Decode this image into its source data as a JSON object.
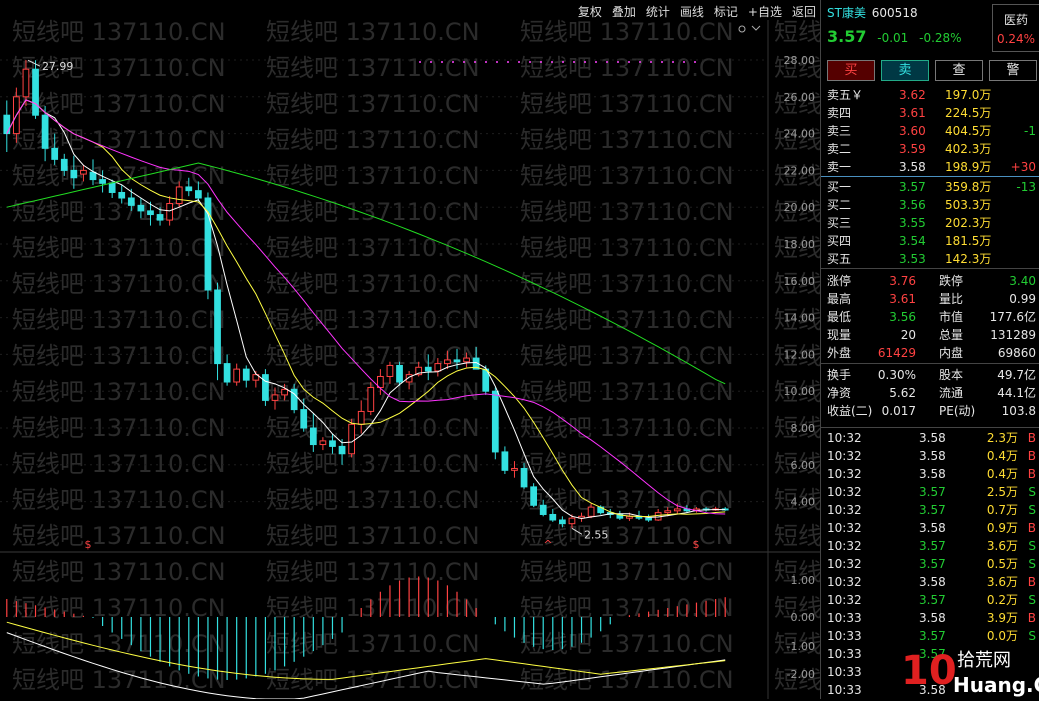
{
  "toolbar": [
    "复权",
    "叠加",
    "统计",
    "画线",
    "标记",
    "+自选",
    "返回"
  ],
  "stock": {
    "name": "ST康美",
    "code": "600518",
    "price": "3.57",
    "change": "-0.01",
    "pct": "-0.28%",
    "sector": "医药",
    "sector_pct": "0.24%"
  },
  "buttons": [
    "买",
    "卖",
    "查",
    "警"
  ],
  "asks": [
    {
      "label": "卖五￥",
      "price": "3.62",
      "vol": "197.0万",
      "delta": ""
    },
    {
      "label": "卖四",
      "price": "3.61",
      "vol": "224.5万",
      "delta": ""
    },
    {
      "label": "卖三",
      "price": "3.60",
      "vol": "404.5万",
      "delta": "-1"
    },
    {
      "label": "卖二",
      "price": "3.59",
      "vol": "402.3万",
      "delta": ""
    },
    {
      "label": "卖一",
      "price": "3.58",
      "vol": "198.9万",
      "delta": "+30"
    }
  ],
  "bids": [
    {
      "label": "买一",
      "price": "3.57",
      "vol": "359.8万",
      "delta": "-13"
    },
    {
      "label": "买二",
      "price": "3.56",
      "vol": "503.3万",
      "delta": ""
    },
    {
      "label": "买三",
      "price": "3.55",
      "vol": "202.3万",
      "delta": ""
    },
    {
      "label": "买四",
      "price": "3.54",
      "vol": "181.5万",
      "delta": ""
    },
    {
      "label": "买五",
      "price": "3.53",
      "vol": "142.3万",
      "delta": ""
    }
  ],
  "stats": [
    {
      "k1": "涨停",
      "v1": "3.76",
      "k2": "跌停",
      "v2": "3.40"
    },
    {
      "k1": "最高",
      "v1": "3.61",
      "k2": "量比",
      "v2": "0.99"
    },
    {
      "k1": "最低",
      "v1": "3.56",
      "k2": "市值",
      "v2": "177.6亿"
    },
    {
      "k1": "现量",
      "v1": "20",
      "k2": "总量",
      "v2": "131289"
    },
    {
      "k1": "外盘",
      "v1": "61429",
      "k2": "内盘",
      "v2": "69860"
    },
    {
      "k1": "换手",
      "v1": "0.30%",
      "k2": "股本",
      "v2": "49.7亿"
    },
    {
      "k1": "净资",
      "v1": "5.62",
      "k2": "流通",
      "v2": "44.1亿"
    },
    {
      "k1": "收益(二)",
      "v1": "0.017",
      "k2": "PE(动)",
      "v2": "103.8"
    }
  ],
  "ticks": [
    {
      "t": "10:32",
      "p": "3.58",
      "v": "2.3万",
      "d": "B"
    },
    {
      "t": "10:32",
      "p": "3.58",
      "v": "0.4万",
      "d": "B"
    },
    {
      "t": "10:32",
      "p": "3.58",
      "v": "0.4万",
      "d": "B"
    },
    {
      "t": "10:32",
      "p": "3.57",
      "v": "2.5万",
      "d": "S"
    },
    {
      "t": "10:32",
      "p": "3.57",
      "v": "0.7万",
      "d": "S"
    },
    {
      "t": "10:32",
      "p": "3.58",
      "v": "0.9万",
      "d": "B"
    },
    {
      "t": "10:32",
      "p": "3.57",
      "v": "3.6万",
      "d": "S"
    },
    {
      "t": "10:32",
      "p": "3.57",
      "v": "0.5万",
      "d": "S"
    },
    {
      "t": "10:32",
      "p": "3.58",
      "v": "3.6万",
      "d": "B"
    },
    {
      "t": "10:32",
      "p": "3.57",
      "v": "0.2万",
      "d": "S"
    },
    {
      "t": "10:33",
      "p": "3.58",
      "v": "3.9万",
      "d": "B"
    },
    {
      "t": "10:33",
      "p": "3.57",
      "v": "0.0万",
      "d": "S"
    },
    {
      "t": "10:33",
      "p": "3.57",
      "v": "",
      "d": ""
    },
    {
      "t": "10:33",
      "p": "",
      "v": "",
      "d": ""
    },
    {
      "t": "10:33",
      "p": "3.58",
      "v": "",
      "d": ""
    }
  ],
  "axis": {
    "price": [
      "28.00",
      "26.00",
      "24.00",
      "22.00",
      "20.00",
      "18.00",
      "16.00",
      "14.00",
      "12.00",
      "10.00",
      "8.00",
      "6.00",
      "4.00"
    ],
    "macd": [
      "1.00",
      "0.00",
      "-1.00",
      "-2.00"
    ]
  },
  "annotations": {
    "high": "27.99",
    "low": "2.55"
  },
  "watermark": "短线吧 137110.CN",
  "logo": "10 拾荒网 Huang.CN",
  "colors": {
    "up": "#ff4242",
    "down": "#33e0e0",
    "ma5": "#ffffff",
    "ma10": "#ffff44",
    "ma20": "#ff33ff",
    "ma60": "#22dd22"
  }
}
